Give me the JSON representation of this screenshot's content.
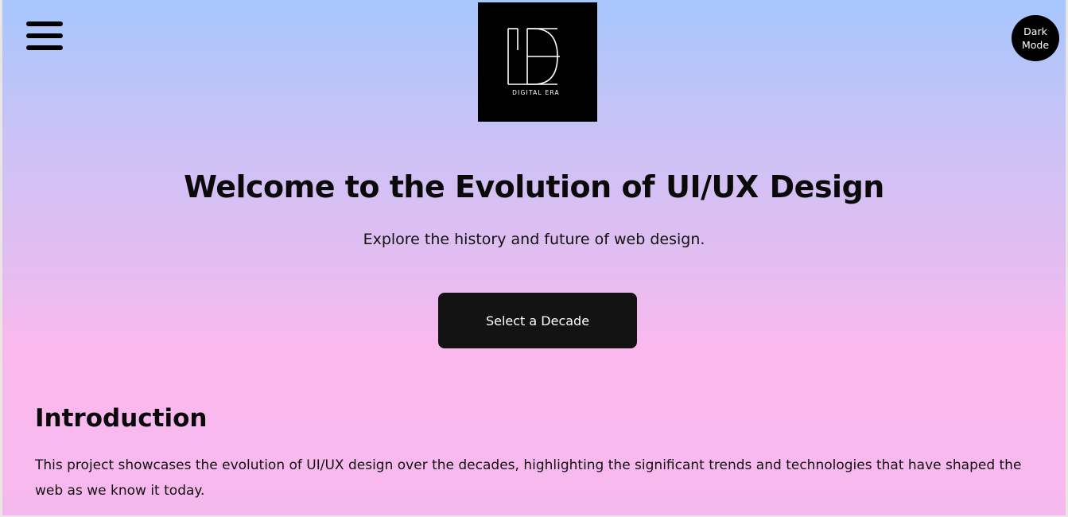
{
  "header": {
    "menu_icon": "hamburger-menu-icon",
    "logo": {
      "monogram": "DE",
      "tagline": "DIGITAL ERA",
      "background": "#000000",
      "foreground": "#ffffff"
    },
    "theme_toggle": {
      "line1": "Dark",
      "line2": "Mode"
    }
  },
  "hero": {
    "title_prefix": "Welcome to the Evolution of",
    "title_highlight": "UI/UX",
    "title_suffix": "Design",
    "subtitle": "Explore the history and future of web design.",
    "cta_label": "Select a Decade"
  },
  "intro": {
    "heading": "Introduction",
    "text": "This project showcases the evolution of UI/UX design over the decades, highlighting the significant trends and technologies that have shaped the web as we know it today."
  },
  "colors": {
    "gradient_top": "#a6c7fd",
    "gradient_mid": "#fbb9ed",
    "button_bg": "#131313",
    "text": "#0a0a0a"
  }
}
